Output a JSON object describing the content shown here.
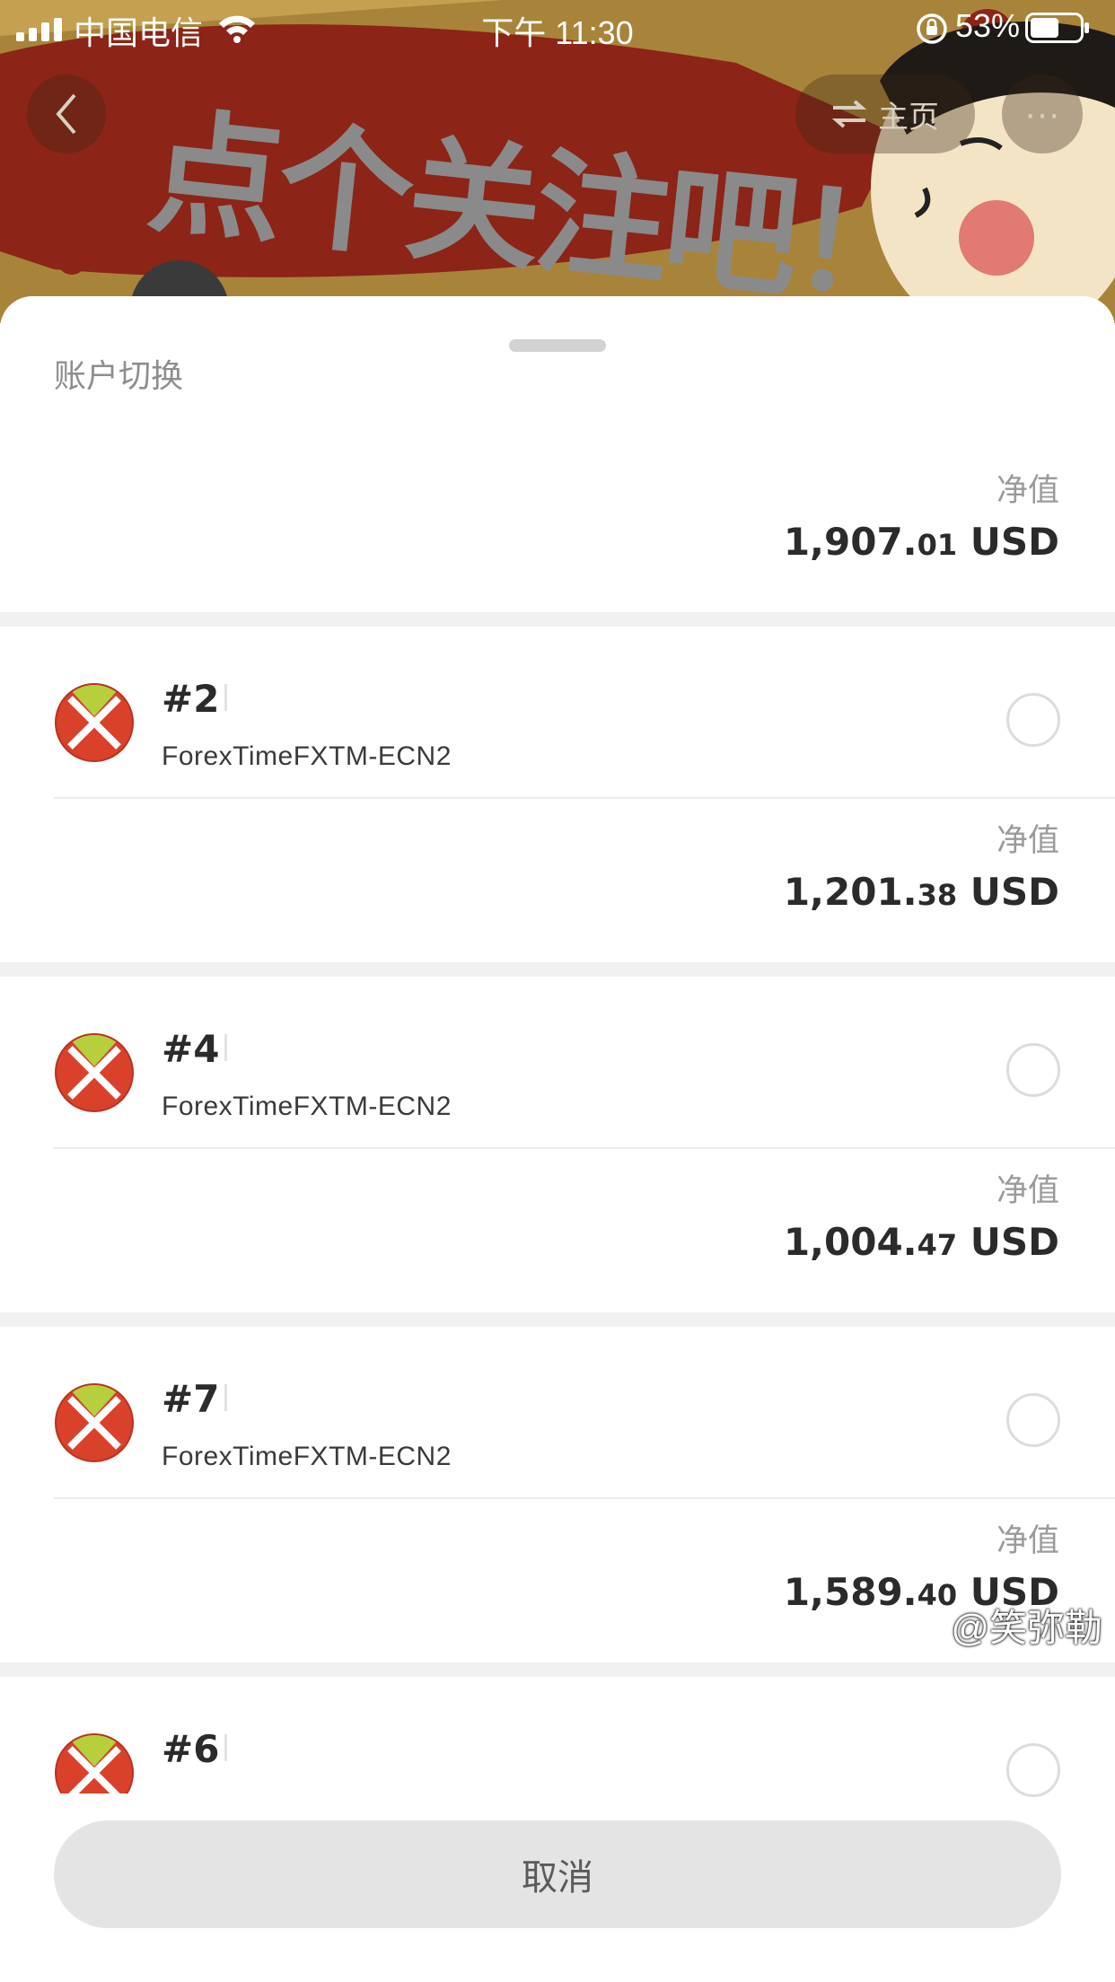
{
  "status_bar": {
    "carrier": "中国电信",
    "time": "下午 11:30",
    "battery_pct": "53%"
  },
  "banner": {
    "text": "点个关注吧！",
    "home_label": "主页",
    "more_label": "···"
  },
  "sheet": {
    "title": "账户切换",
    "equity_label": "净值",
    "top_equity": {
      "int": "1,907.",
      "frac": "01",
      "cur": " USD"
    },
    "accounts": [
      {
        "num": "#2",
        "server": "ForexTimeFXTM-ECN2",
        "equity_int": "1,201.",
        "equity_frac": "38",
        "cur": " USD",
        "selected": false
      },
      {
        "num": "#4",
        "server": "ForexTimeFXTM-ECN2",
        "equity_int": "1,004.",
        "equity_frac": "47",
        "cur": " USD",
        "selected": false
      },
      {
        "num": "#7",
        "server": "ForexTimeFXTM-ECN2",
        "equity_int": "1,589.",
        "equity_frac": "40",
        "cur": " USD",
        "selected": false
      },
      {
        "num": "#6",
        "selected": false
      }
    ],
    "cancel_label": "取消"
  },
  "watermark": "@笑弥勒",
  "colors": {
    "banner_bg": "#a8843a",
    "banner_splash": "#8c2418",
    "sheet_bg": "#ffffff",
    "band": "#f1f1f1",
    "cancel_bg": "#e4e4e4",
    "logo_red": "#d9412a",
    "logo_green": "#b6cf3a"
  },
  "icons": [
    "signal-icon",
    "wifi-icon",
    "rotation-lock-icon",
    "battery-icon",
    "back-icon",
    "swap-icon",
    "more-icon",
    "broker-logo-icon",
    "radio-icon"
  ]
}
